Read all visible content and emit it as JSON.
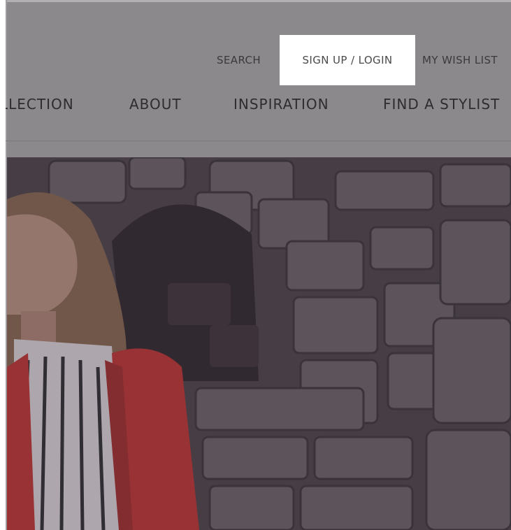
{
  "utility_nav": {
    "search": "SEARCH",
    "login": "SIGN UP / LOGIN",
    "wishlist": "MY WISH LIST"
  },
  "main_nav": {
    "items": [
      {
        "label": "LLECTION"
      },
      {
        "label": "ABOUT"
      },
      {
        "label": "INSPIRATION"
      },
      {
        "label": "FIND A STYLIST"
      }
    ]
  },
  "colors": {
    "overlay": "#8c898c",
    "highlight": "#ffffff",
    "jacket": "#c8322f"
  },
  "icons": {
    "hero": "hero-image"
  }
}
